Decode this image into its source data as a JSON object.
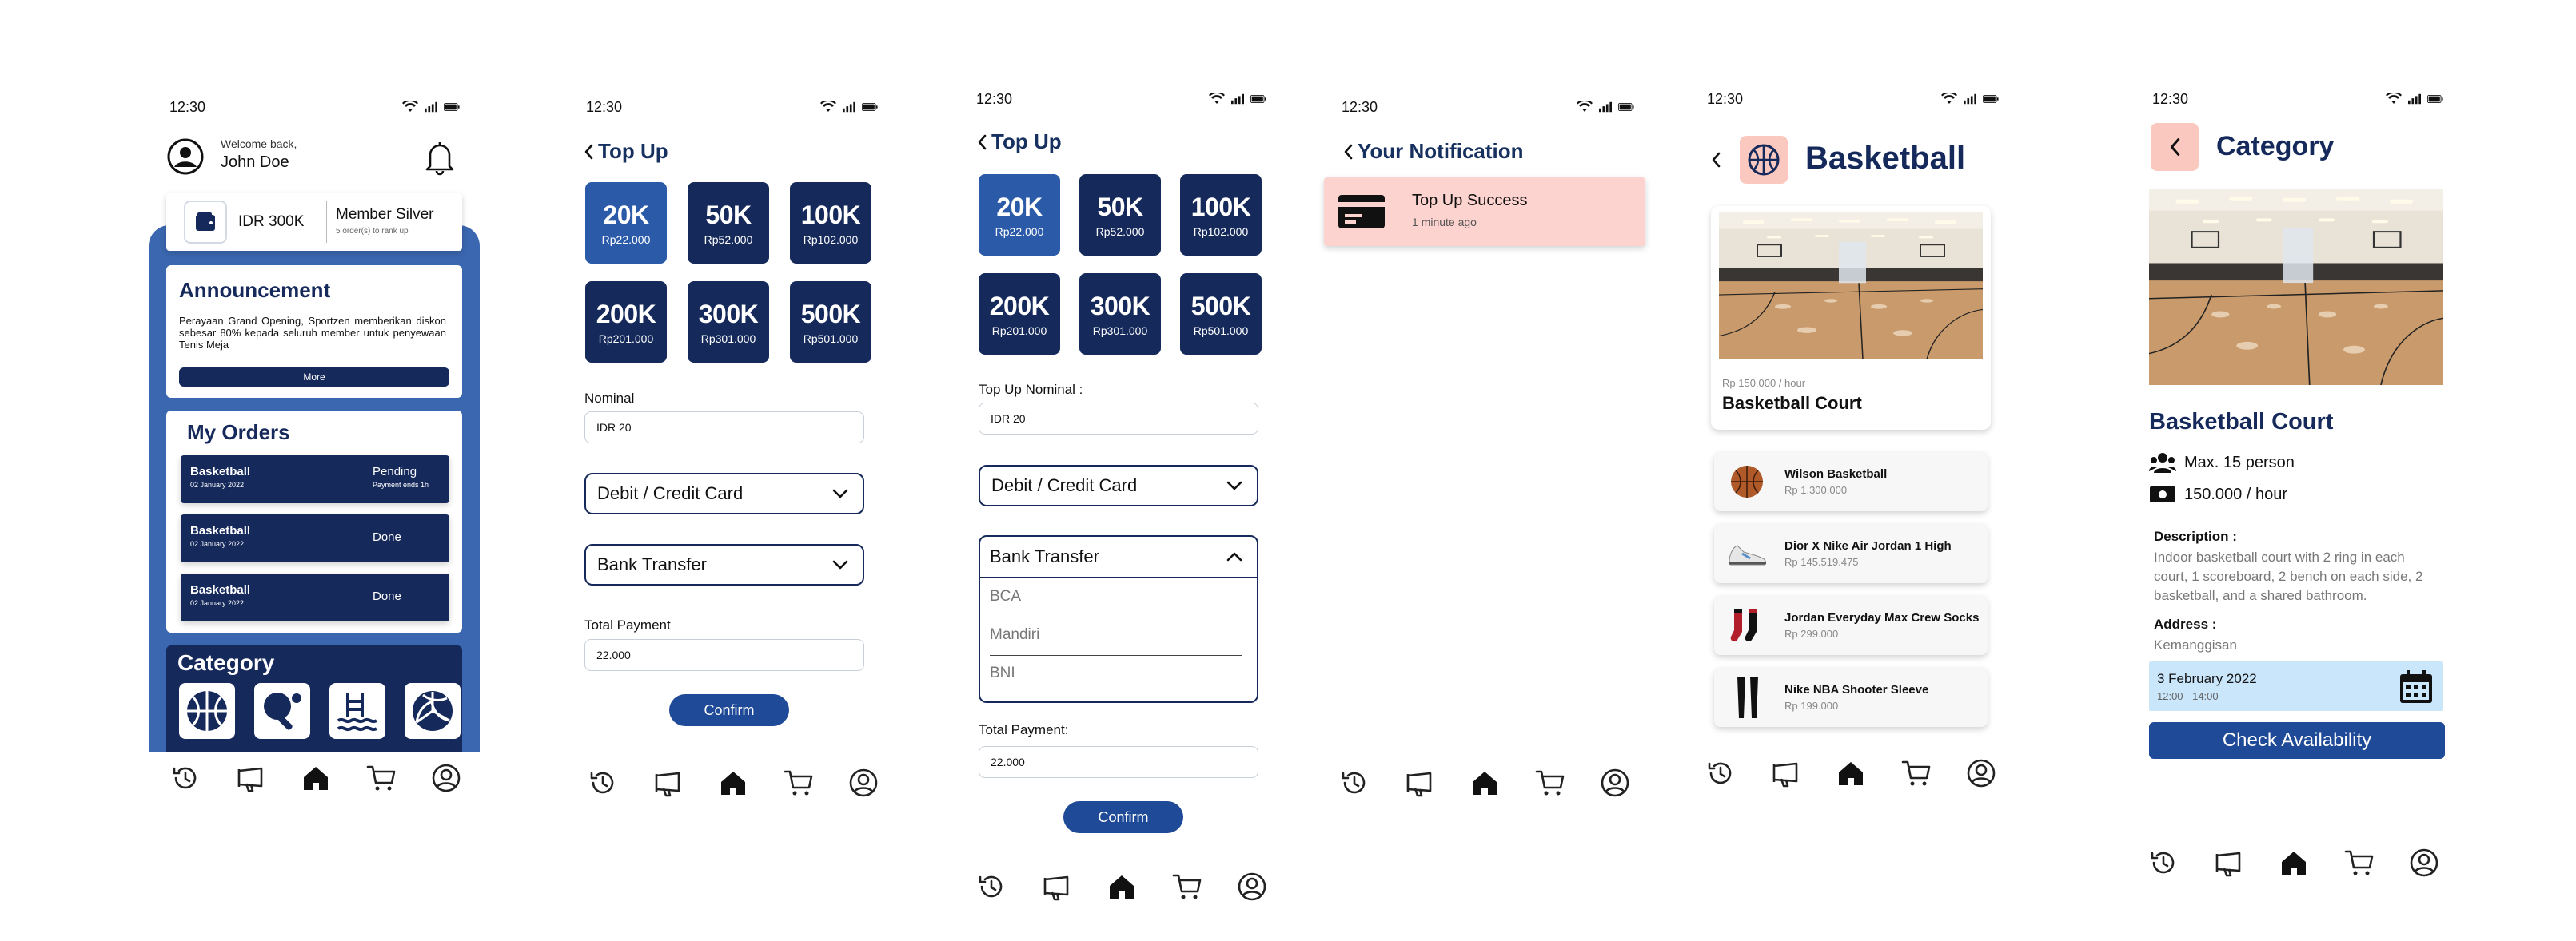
{
  "status_time": "12:30",
  "nav_icons": [
    "history-icon",
    "megaphone-icon",
    "home-icon",
    "cart-icon",
    "profile-icon"
  ],
  "screen1": {
    "welcome": "Welcome back,",
    "user_name": "John Doe",
    "balance": "IDR 300K",
    "member": "Member Silver",
    "member_sub": "5 order(s) to rank up",
    "announcement_title": "Announcement",
    "announcement_text": "Perayaan Grand Opening, Sportzen memberikan diskon sebesar 80% kepada seluruh member untuk penyewaan Tenis Meja",
    "more_label": "More",
    "orders_title": "My Orders",
    "orders": [
      {
        "name": "Basketball",
        "date": "02 January 2022",
        "status": "Pending",
        "sub": "Payment ends 1h"
      },
      {
        "name": "Basketball",
        "date": "02 January 2022",
        "status": "Done",
        "sub": ""
      },
      {
        "name": "Basketball",
        "date": "02 January 2022",
        "status": "Done",
        "sub": ""
      }
    ],
    "category_title": "Category",
    "categories": [
      "basketball-icon",
      "table-tennis-icon",
      "swimming-icon",
      "volleyball-icon"
    ]
  },
  "topup": {
    "title": "Top Up",
    "tiles": [
      {
        "amount": "20K",
        "price": "Rp22.000"
      },
      {
        "amount": "50K",
        "price": "Rp52.000"
      },
      {
        "amount": "100K",
        "price": "Rp102.000"
      },
      {
        "amount": "200K",
        "price": "Rp201.000"
      },
      {
        "amount": "300K",
        "price": "Rp301.000"
      },
      {
        "amount": "500K",
        "price": "Rp501.000"
      }
    ],
    "nominal_label": "Nominal",
    "nominal_label_alt": "Top Up Nominal :",
    "nominal_value": "IDR 20",
    "method_card": "Debit / Credit Card",
    "method_bank": "Bank Transfer",
    "banks": [
      "BCA",
      "Mandiri",
      "BNI"
    ],
    "total_label": "Total Payment",
    "total_label_alt": "Total Payment:",
    "total_value": "22.000",
    "confirm": "Confirm"
  },
  "notification": {
    "title": "Your Notification",
    "item_title": "Top Up Success",
    "item_time": "1 minute ago"
  },
  "basketball": {
    "title": "Basketball",
    "price_hour": "Rp 150.000 / hour",
    "court_name": "Basketball Court",
    "products": [
      {
        "name": "Wilson Basketball",
        "price": "Rp 1.300.000"
      },
      {
        "name": "Dior X Nike Air Jordan 1 High",
        "price": "Rp 145.519.475"
      },
      {
        "name": "Jordan Everyday Max Crew Socks",
        "price": "Rp 299.000"
      },
      {
        "name": "Nike NBA Shooter Sleeve",
        "price": "Rp 199.000"
      }
    ]
  },
  "category_detail": {
    "title": "Category",
    "court_name": "Basketball Court",
    "capacity": "Max. 15 person",
    "price": "150.000 / hour",
    "desc_label": "Description :",
    "desc": "Indoor basketball court with 2 ring in each court, 1 scoreboard, 2 bench on each side, 2 basketball, and a shared bathroom.",
    "address_label": "Address :",
    "address": "Kemanggisan",
    "date": "3 February 2022",
    "time": "12:00 - 14:00",
    "check": "Check Availability"
  },
  "colors": {
    "navy": "#15295b",
    "blue": "#2a5aa8",
    "panel": "#3b67b0",
    "pink": "#fdd3cf",
    "light_blue": "#c9e6fb"
  }
}
